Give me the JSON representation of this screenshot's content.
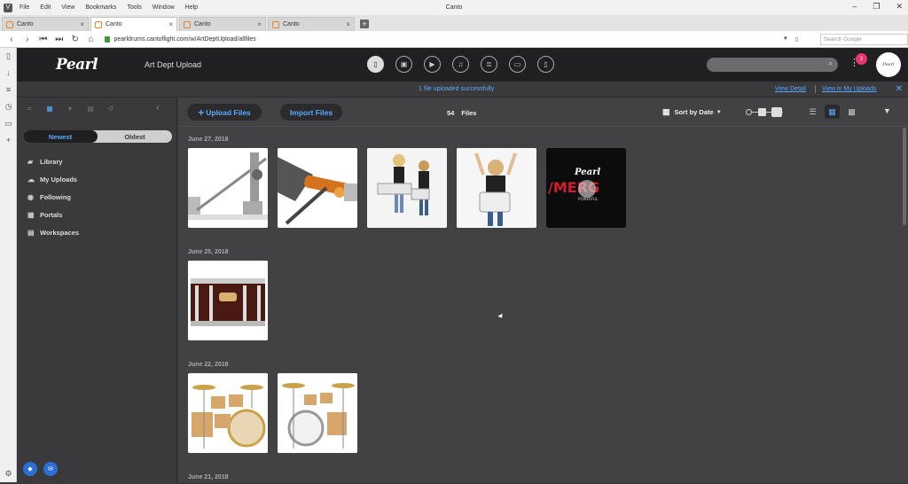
{
  "browser": {
    "menu": [
      "File",
      "Edit",
      "View",
      "Bookmarks",
      "Tools",
      "Window",
      "Help"
    ],
    "window_title": "Canto",
    "tabs": [
      {
        "label": "Canto",
        "active": false
      },
      {
        "label": "Canto",
        "active": true
      },
      {
        "label": "Canto",
        "active": false
      },
      {
        "label": "Canto",
        "active": false
      }
    ],
    "url": "pearldrums.cantoflight.com/w/ArtDeptUpload/allfiles",
    "search_placeholder": "Search Google"
  },
  "app": {
    "logo_text": "Pearl",
    "title": "Art Dept Upload",
    "notification_count": "2",
    "avatar_text": "Pearl"
  },
  "notice": {
    "message": "1 file uploaded successfully",
    "view_detail": "View Detail",
    "view_in_uploads": "View in My Uploads"
  },
  "sidebar": {
    "sort_newest": "Newest",
    "sort_oldest": "Oldest",
    "items": [
      {
        "label": "Library",
        "icon": "folder-icon"
      },
      {
        "label": "My Uploads",
        "icon": "cloud-upload-icon"
      },
      {
        "label": "Following",
        "icon": "eye-icon"
      },
      {
        "label": "Portals",
        "icon": "grid-icon"
      },
      {
        "label": "Workspaces",
        "icon": "workspace-icon"
      }
    ]
  },
  "toolbar": {
    "upload_label": "Upload Files",
    "import_label": "Import Files",
    "file_count": "54",
    "files_label": "Files",
    "sort_label": "Sort by Date"
  },
  "groups": [
    {
      "date": "June 27, 2018",
      "thumbs": [
        "pedal",
        "pedal-orange",
        "kids-marching",
        "boy-drum",
        "emerge-logo"
      ]
    },
    {
      "date": "June 25, 2018",
      "thumbs": [
        "snare-drum"
      ]
    },
    {
      "date": "June 22, 2018",
      "thumbs": [
        "drum-kit-natural",
        "drum-kit-white"
      ]
    },
    {
      "date": "June 21, 2018",
      "thumbs": []
    }
  ],
  "colors": {
    "accent": "#5aa9ff",
    "header_bg": "#202022",
    "badge": "#e8336b"
  }
}
